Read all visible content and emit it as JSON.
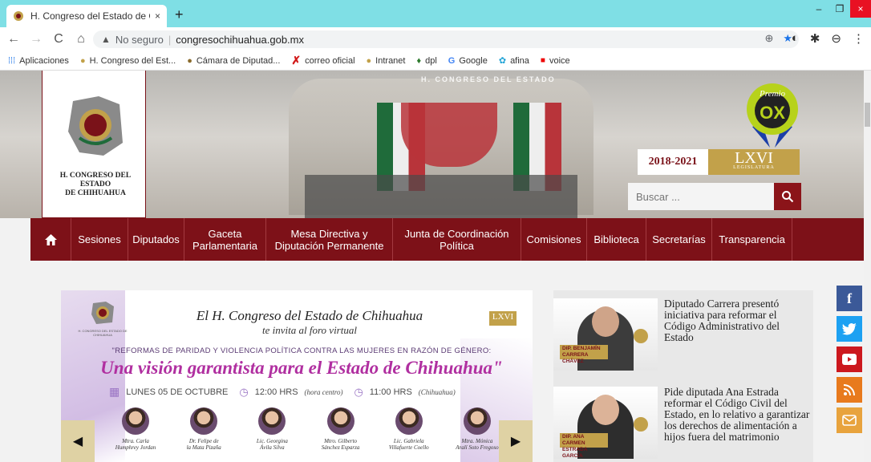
{
  "browser": {
    "tab_title": "H. Congreso del Estado de Chihu",
    "tab_close": "×",
    "new_tab": "+",
    "window_controls": [
      "–",
      "❐",
      "×"
    ],
    "nav": {
      "back": "←",
      "forward": "→",
      "reload": "C",
      "home": "⌂"
    },
    "address": {
      "warning_icon": "▲",
      "security_label": "No seguro",
      "separator": "|",
      "url": "congresochihuahua.gob.mx"
    },
    "omnibox_icons": [
      "⊕",
      "★"
    ],
    "extension_icons": [
      "◐",
      "✱",
      "⊖",
      "⋮"
    ],
    "bookmarks": [
      {
        "icon": "grid-icon",
        "label": "Aplicaciones"
      },
      {
        "icon": "seal-icon",
        "label": "H. Congreso del Est..."
      },
      {
        "icon": "camara-icon",
        "label": "Cámara de Diputad..."
      },
      {
        "icon": "x-icon",
        "label": "correo oficial"
      },
      {
        "icon": "seal-icon",
        "label": "Intranet"
      },
      {
        "icon": "dpl-icon",
        "label": "dpl"
      },
      {
        "icon": "google-icon",
        "label": "Google"
      },
      {
        "icon": "afina-icon",
        "label": "afina"
      },
      {
        "icon": "voice-icon",
        "label": "voice"
      }
    ]
  },
  "header": {
    "logo_name_line1": "H. CONGRESO DEL ESTADO",
    "logo_name_line2": "DE CHIHUAHUA",
    "banner_caption": "H. CONGRESO DEL ESTADO",
    "premio_label": "Premio",
    "years": "2018-2021",
    "legislatura_roman": "LXVI",
    "legislatura_word": "LEGISLATURA",
    "search_placeholder": "Buscar ...",
    "colors": {
      "maroon": "#7d1118",
      "gold": "#c2a14a"
    }
  },
  "nav": {
    "items": [
      {
        "label": "Sesiones"
      },
      {
        "label": "Diputados"
      },
      {
        "label": "Gaceta Parlamentaria"
      },
      {
        "label": "Mesa Directiva y Diputación Permanente"
      },
      {
        "label": "Junta de Coordinación Política"
      },
      {
        "label": "Comisiones"
      },
      {
        "label": "Biblioteca"
      },
      {
        "label": "Secretarías"
      },
      {
        "label": "Transparencia"
      }
    ]
  },
  "slider": {
    "org_small": "H. CONGRESO DEL ESTADO DE CHIHUAHUA",
    "title": "El H. Congreso del Estado de Chihuahua",
    "subtitle": "te invita al foro virtual",
    "badge": "LXVI",
    "topic": "\"REFORMAS DE PARIDAD Y VIOLENCIA POLÍTICA CONTRA LAS MUJERES EN RAZÓN DE GÉNERO:",
    "headline": "Una visión garantista para el Estado de Chihuahua\"",
    "date": "LUNES 05 DE OCTUBRE",
    "time1": "12:00 HRS",
    "time1_note": "(hora centro)",
    "time2": "11:00 HRS",
    "time2_note": "(Chihuahua)",
    "speakers": [
      {
        "l1": "Mtra. Carla",
        "l2": "Humphrey Jordan"
      },
      {
        "l1": "Dr. Felipe de",
        "l2": "la Mata Pizaña"
      },
      {
        "l1": "Lic. Georgina",
        "l2": "Ávila Silva"
      },
      {
        "l1": "Mtro. Gilberto",
        "l2": "Sánchez Esparza"
      },
      {
        "l1": "Lic. Gabriela",
        "l2": "Villafuerte Coello"
      },
      {
        "l1": "Mtra. Mónica",
        "l2": "Aralí Soto Fregoso"
      }
    ],
    "prev_label": "◀",
    "next_label": "▶"
  },
  "news": [
    {
      "tag_line1": "DIP. BENJAMÍN",
      "tag_line2": "CARRERA CHÁVEZ",
      "text": "Diputado Carrera presentó iniciativa para reformar el Código Administrativo del Estado"
    },
    {
      "tag_line1": "DIP. ANA CARMEN",
      "tag_line2": "ESTRADA GARCÍA",
      "text": "Pide diputada Ana Estrada reformar el Código Civil del Estado, en lo relativo a garantizar los derechos de alimentación a hijos fuera del matrimonio"
    }
  ],
  "social": [
    {
      "name": "facebook",
      "glyph": "f",
      "color": "#3b5998"
    },
    {
      "name": "twitter",
      "glyph": "t",
      "color": "#1da1f2"
    },
    {
      "name": "youtube",
      "glyph": "▶",
      "color": "#cc181e"
    },
    {
      "name": "rss",
      "glyph": "◥",
      "color": "#e87a1d"
    },
    {
      "name": "email",
      "glyph": "✉",
      "color": "#e8a33d"
    }
  ]
}
